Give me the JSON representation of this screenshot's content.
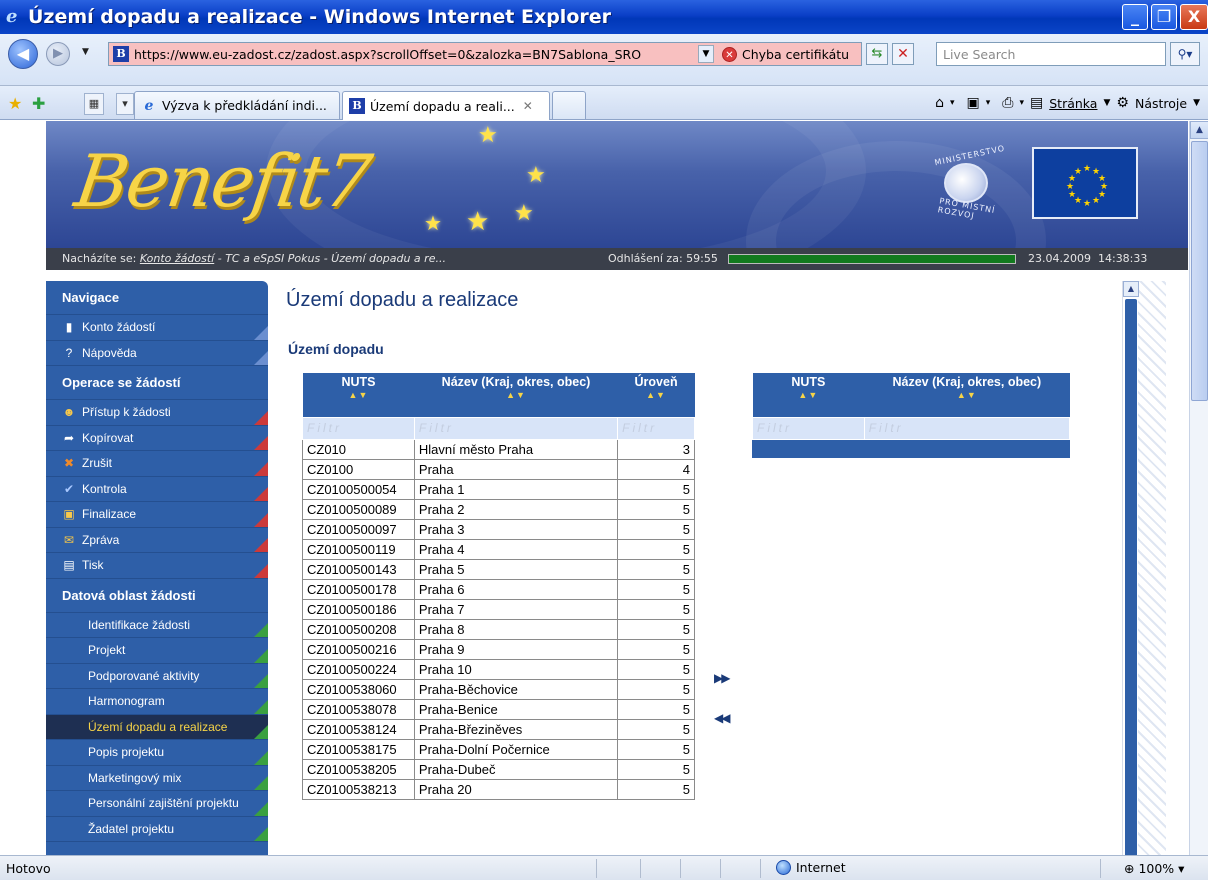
{
  "window": {
    "title": "Území dopadu a realizace - Windows Internet Explorer",
    "btn_min": "_",
    "btn_max": "❐",
    "btn_close": "X"
  },
  "address": {
    "url": "https://www.eu-zadost.cz/zadost.aspx?scrollOffset=0&zalozka=BN7Sablona_SRO",
    "cert_error": "Chyba certifikátu",
    "search_placeholder": "Live Search"
  },
  "tabs": [
    {
      "label": "Výzva k předkládání indi..."
    },
    {
      "label": "Území dopadu a reali..."
    }
  ],
  "commandbar": {
    "page_label": "Stránka",
    "tools_label": "Nástroje"
  },
  "header": {
    "logo": "Benefit7",
    "ministry_top": "MINISTERSTVO",
    "ministry_bottom": "PRO MÍSTNÍ ROZVOJ"
  },
  "breadcrumb": {
    "prefix": "Nacházíte se: ",
    "link": "Konto žádostí",
    "rest": " - TC a eSpSI Pokus - Území dopadu a re...",
    "logout_label": "Odhlášení za: 59:55",
    "logout_progress": 1.0,
    "date": "23.04.2009",
    "time": "14:38:33"
  },
  "nav": {
    "section_navigation": "Navigace",
    "items_nav": [
      {
        "label": "Konto žádostí",
        "icon": "book-icon"
      },
      {
        "label": "Nápověda",
        "icon": "help-icon"
      }
    ],
    "section_operations": "Operace se žádostí",
    "items_ops": [
      {
        "label": "Přístup k žádosti",
        "icon": "users-icon"
      },
      {
        "label": "Kopírovat",
        "icon": "copy-arrow-icon"
      },
      {
        "label": "Zrušit",
        "icon": "cancel-icon"
      },
      {
        "label": "Kontrola",
        "icon": "check-icon"
      },
      {
        "label": "Finalizace",
        "icon": "lock-icon"
      },
      {
        "label": "Zpráva",
        "icon": "mail-icon"
      },
      {
        "label": "Tisk",
        "icon": "print-icon"
      }
    ],
    "section_data": "Datová oblast žádosti",
    "items_data": [
      {
        "label": "Identifikace žádosti"
      },
      {
        "label": "Projekt"
      },
      {
        "label": "Podporované aktivity"
      },
      {
        "label": "Harmonogram"
      },
      {
        "label": "Území dopadu a realizace",
        "active": true
      },
      {
        "label": "Popis projektu"
      },
      {
        "label": "Marketingový mix"
      },
      {
        "label": "Personální zajištění projektu"
      },
      {
        "label": "Žadatel projektu"
      }
    ]
  },
  "main": {
    "title": "Území dopadu a realizace",
    "section": "Území dopadu",
    "filter_placeholder": "Filtr",
    "sort_glyph": "▲▼",
    "left_table": {
      "headers": [
        "NUTS",
        "Název (Kraj, okres, obec)",
        "Úroveň"
      ],
      "rows": [
        [
          "CZ010",
          "Hlavní město Praha",
          "3"
        ],
        [
          "CZ0100",
          "Praha",
          "4"
        ],
        [
          "CZ0100500054",
          "Praha 1",
          "5"
        ],
        [
          "CZ0100500089",
          "Praha 2",
          "5"
        ],
        [
          "CZ0100500097",
          "Praha 3",
          "5"
        ],
        [
          "CZ0100500119",
          "Praha 4",
          "5"
        ],
        [
          "CZ0100500143",
          "Praha 5",
          "5"
        ],
        [
          "CZ0100500178",
          "Praha 6",
          "5"
        ],
        [
          "CZ0100500186",
          "Praha 7",
          "5"
        ],
        [
          "CZ0100500208",
          "Praha 8",
          "5"
        ],
        [
          "CZ0100500216",
          "Praha 9",
          "5"
        ],
        [
          "CZ0100500224",
          "Praha 10",
          "5"
        ],
        [
          "CZ0100538060",
          "Praha-Běchovice",
          "5"
        ],
        [
          "CZ0100538078",
          "Praha-Benice",
          "5"
        ],
        [
          "CZ0100538124",
          "Praha-Březiněves",
          "5"
        ],
        [
          "CZ0100538175",
          "Praha-Dolní Počernice",
          "5"
        ],
        [
          "CZ0100538205",
          "Praha-Dubeč",
          "5"
        ],
        [
          "CZ0100538213",
          "Praha 20",
          "5"
        ]
      ]
    },
    "right_table": {
      "headers": [
        "NUTS",
        "Název (Kraj, okres, obec)"
      ]
    },
    "move_right": "▶▶",
    "move_left": "◀◀"
  },
  "status": {
    "text": "Hotovo",
    "zone": "Internet",
    "zoom": "100%"
  }
}
